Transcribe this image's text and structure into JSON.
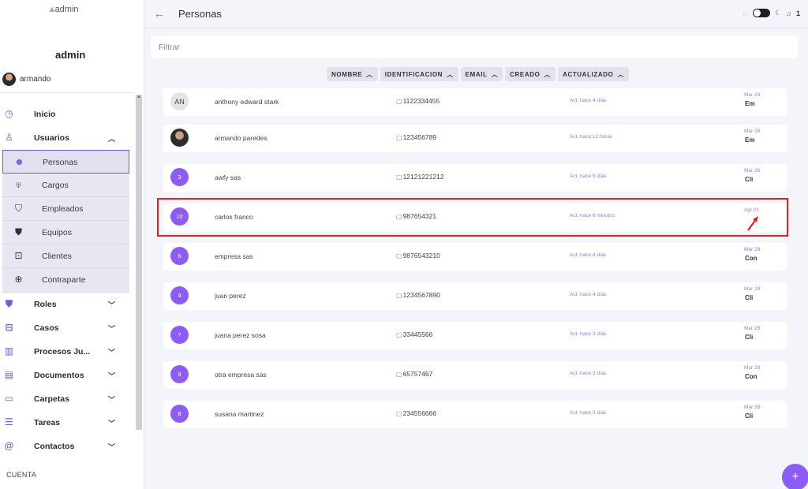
{
  "sidebar": {
    "logo_text": "admin",
    "title": "admin",
    "user": "armando",
    "menu": [
      {
        "label": "Inicio",
        "icon": "clock-icon"
      },
      {
        "label": "Usuarios",
        "icon": "user-icon",
        "expanded": true
      }
    ],
    "submenu": [
      {
        "label": "Personas",
        "icon": "face-icon",
        "active": true
      },
      {
        "label": "Cargos",
        "icon": "trophy-icon"
      },
      {
        "label": "Empleados",
        "icon": "shirt-icon"
      },
      {
        "label": "Equipos",
        "icon": "team-icon"
      },
      {
        "label": "Clientes",
        "icon": "client-icon"
      },
      {
        "label": "Contraparte",
        "icon": "contraparte-icon"
      }
    ],
    "menu2": [
      {
        "label": "Roles",
        "icon": "roles-icon"
      },
      {
        "label": "Casos",
        "icon": "briefcase-icon"
      },
      {
        "label": "Procesos Ju...",
        "icon": "building-icon"
      },
      {
        "label": "Documentos",
        "icon": "document-icon"
      },
      {
        "label": "Carpetas",
        "icon": "folder-icon"
      },
      {
        "label": "Tareas",
        "icon": "list-icon"
      },
      {
        "label": "Contactos",
        "icon": "at-icon"
      }
    ],
    "cuenta": "CUENTA"
  },
  "header": {
    "title": "Personas",
    "notifications": "1"
  },
  "filter": {
    "placeholder": "Filtrar"
  },
  "sort": [
    "NOMBRE",
    "IDENTIFICACION",
    "EMAIL",
    "CREADO",
    "ACTUALIZADO"
  ],
  "rows": [
    {
      "avatar": "AN",
      "avatar_type": "initials",
      "name": "anthony edward stark",
      "id": "1122334455",
      "updated": "Act. hace 4 días",
      "date": "Mar 28",
      "cat": "Em"
    },
    {
      "avatar": "",
      "avatar_type": "photo",
      "name": "armando paredes",
      "id": "123456789",
      "updated": "Act. hace 12 horas",
      "date": "Mar 26",
      "cat": "Em"
    },
    {
      "avatar": "3",
      "avatar_type": "number",
      "name": "awfy sas",
      "id": "12121221212",
      "updated": "Act. hace 5 días",
      "date": "Mar 26",
      "cat": "Cli"
    },
    {
      "avatar": "10",
      "avatar_type": "number",
      "name": "carlos franco",
      "id": "987654321",
      "updated": "Act. hace 6 minutos",
      "date": "Apr 01",
      "cat": ""
    },
    {
      "avatar": "5",
      "avatar_type": "number",
      "name": "empresa sas",
      "id": "9876543210",
      "updated": "Act. hace 4 días",
      "date": "Mar 28",
      "cat": "Con"
    },
    {
      "avatar": "4",
      "avatar_type": "number",
      "name": "juan perez",
      "id": "1234567890",
      "updated": "Act. hace 4 días",
      "date": "Mar 28",
      "cat": "Cli"
    },
    {
      "avatar": "7",
      "avatar_type": "number",
      "name": "juana perez sosa",
      "id": "33445566",
      "updated": "Act. hace 3 días",
      "date": "Mar 28",
      "cat": "Cli"
    },
    {
      "avatar": "9",
      "avatar_type": "number",
      "name": "otra empresa sas",
      "id": "65757467",
      "updated": "Act. hace 3 días",
      "date": "Mar 28",
      "cat": "Con"
    },
    {
      "avatar": "8",
      "avatar_type": "number",
      "name": "susana martinez",
      "id": "234556666",
      "updated": "Act. hace 3 días",
      "date": "Mar 28",
      "cat": "Cli"
    }
  ],
  "fab": "+",
  "colors": {
    "accent": "#8b5cf6",
    "highlight": "#e62020"
  }
}
